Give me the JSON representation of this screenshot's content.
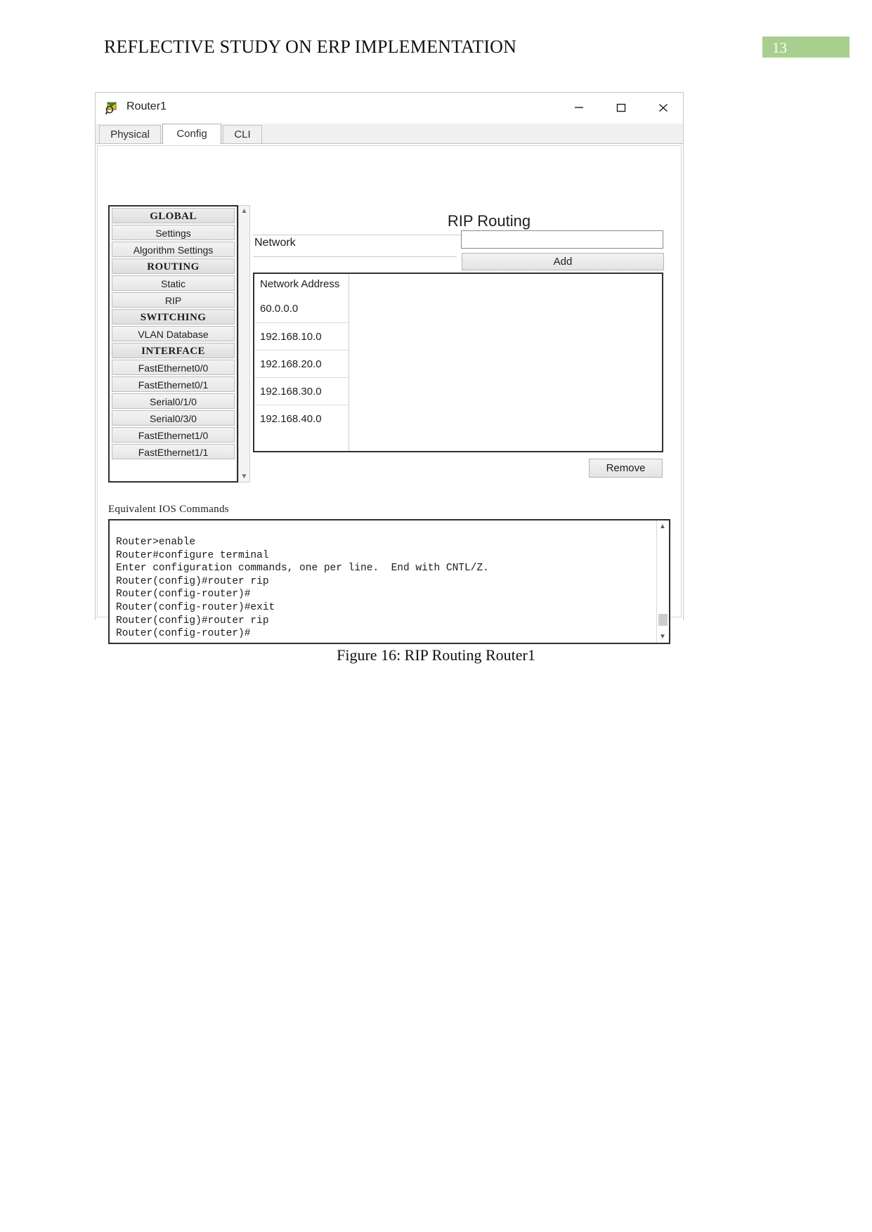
{
  "document": {
    "header_title": "REFLECTIVE STUDY ON ERP IMPLEMENTATION",
    "page_number": "13",
    "caption": "Figure 16: RIP Routing Router1",
    "badge_color": "#a9cf8f"
  },
  "window": {
    "title": "Router1",
    "icon": "router-device-icon",
    "controls": {
      "minimize": "minimize-icon",
      "maximize": "maximize-icon",
      "close": "close-icon"
    }
  },
  "tabs": [
    {
      "label": "Physical",
      "active": false
    },
    {
      "label": "Config",
      "active": true
    },
    {
      "label": "CLI",
      "active": false
    }
  ],
  "sidebar": {
    "items": [
      {
        "label": "GLOBAL",
        "header": true
      },
      {
        "label": "Settings",
        "header": false
      },
      {
        "label": "Algorithm Settings",
        "header": false
      },
      {
        "label": "ROUTING",
        "header": true
      },
      {
        "label": "Static",
        "header": false
      },
      {
        "label": "RIP",
        "header": false
      },
      {
        "label": "SWITCHING",
        "header": true
      },
      {
        "label": "VLAN Database",
        "header": false
      },
      {
        "label": "INTERFACE",
        "header": true
      },
      {
        "label": "FastEthernet0/0",
        "header": false
      },
      {
        "label": "FastEthernet0/1",
        "header": false
      },
      {
        "label": "Serial0/1/0",
        "header": false
      },
      {
        "label": "Serial0/3/0",
        "header": false
      },
      {
        "label": "FastEthernet1/0",
        "header": false
      },
      {
        "label": "FastEthernet1/1",
        "header": false
      }
    ],
    "scroll_up_icon": "chevron-up-icon",
    "scroll_down_icon": "chevron-down-icon"
  },
  "main": {
    "panel_title": "RIP Routing",
    "network_label": "Network",
    "network_input_value": "",
    "network_input_placeholder": "",
    "add_label": "Add",
    "remove_label": "Remove",
    "table": {
      "column_header": "Network Address",
      "rows": [
        "60.0.0.0",
        "192.168.10.0",
        "192.168.20.0",
        "192.168.30.0",
        "192.168.40.0"
      ]
    }
  },
  "ios": {
    "label": "Equivalent IOS Commands",
    "lines": "Router>enable\nRouter#configure terminal\nEnter configuration commands, one per line.  End with CNTL/Z.\nRouter(config)#router rip\nRouter(config-router)#\nRouter(config-router)#exit\nRouter(config)#router rip\nRouter(config-router)#",
    "scroll_up_icon": "chevron-up-icon",
    "scroll_down_icon": "chevron-down-icon"
  }
}
